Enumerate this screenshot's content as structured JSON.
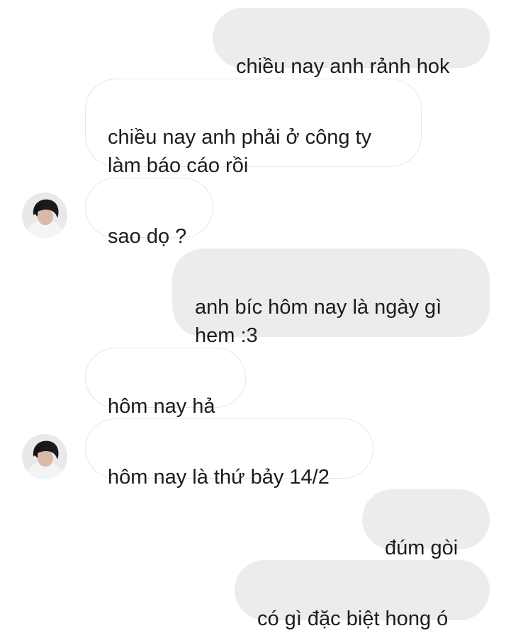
{
  "messages": [
    {
      "side": "outgoing",
      "text": "chiều nay anh rảnh hok"
    },
    {
      "side": "incoming",
      "text": "chiều nay anh phải ở công ty\nlàm báo cáo rồi"
    },
    {
      "side": "incoming",
      "text": "sao dọ ?",
      "show_avatar": true
    },
    {
      "side": "outgoing",
      "text": "anh bíc hôm nay là ngày gì\nhem :3"
    },
    {
      "side": "incoming",
      "text": "hôm nay hả"
    },
    {
      "side": "incoming",
      "text": "hôm nay là thứ bảy 14/2",
      "show_avatar": true
    },
    {
      "side": "outgoing",
      "text": "đúm gòi"
    },
    {
      "side": "outgoing",
      "text": "có gì đặc biệt hong ó"
    }
  ],
  "colors": {
    "outgoing_bubble": "#ececec",
    "incoming_bubble": "#ffffff",
    "incoming_border": "#e6e6e6",
    "text": "#1c1c1c"
  },
  "avatar_icon": "user-photo"
}
